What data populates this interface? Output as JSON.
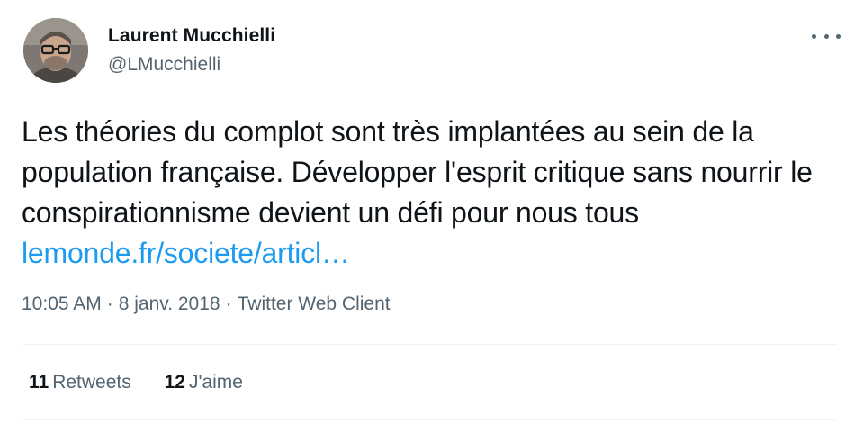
{
  "author": {
    "display_name": "Laurent Mucchielli",
    "handle": "@LMucchielli"
  },
  "more_icon": "more-horizontal-icon",
  "tweet": {
    "text": "Les théories du complot sont très implantées au sein de la population française. Développer l'esprit critique sans nourrir le conspirationnisme devient un défi pour nous tous ",
    "link_text": "lemonde.fr/societe/articl…"
  },
  "meta": {
    "time": "10:05 AM",
    "separator": "·",
    "date": "8 janv. 2018",
    "source": "Twitter Web Client"
  },
  "stats": {
    "retweets_count": "11",
    "retweets_label": "Retweets",
    "likes_count": "12",
    "likes_label": "J'aime"
  },
  "colors": {
    "link": "#1d9bf0",
    "secondary_text": "#536471",
    "primary_text": "#0f1419",
    "divider": "#eff3f4"
  }
}
